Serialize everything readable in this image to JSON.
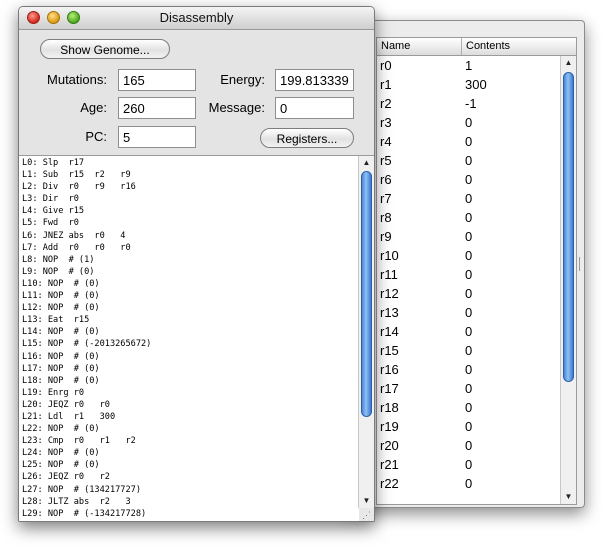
{
  "disassembly_window": {
    "title": "Disassembly",
    "show_genome_label": "Show Genome...",
    "registers_label": "Registers...",
    "fields": {
      "mutations": {
        "label": "Mutations:",
        "value": "165"
      },
      "energy": {
        "label": "Energy:",
        "value": "199.813339"
      },
      "age": {
        "label": "Age:",
        "value": "260"
      },
      "message": {
        "label": "Message:",
        "value": "0"
      },
      "pc": {
        "label": "PC:",
        "value": "5"
      }
    },
    "code": [
      "L0: Slp  r17",
      "L1: Sub  r15  r2   r9",
      "L2: Div  r0   r9   r16",
      "L3: Dir  r0",
      "L4: Give r15",
      "L5: Fwd  r0",
      "L6: JNEZ abs  r0   4",
      "L7: Add  r0   r0   r0",
      "L8: NOP  # (1)",
      "L9: NOP  # (0)",
      "L10: NOP  # (0)",
      "L11: NOP  # (0)",
      "L12: NOP  # (0)",
      "L13: Eat  r15",
      "L14: NOP  # (0)",
      "L15: NOP  # (-2013265672)",
      "L16: NOP  # (0)",
      "L17: NOP  # (0)",
      "L18: NOP  # (0)",
      "L19: Enrg r0",
      "L20: JEQZ r0   r0",
      "L21: Ldl  r1   300",
      "L22: NOP  # (0)",
      "L23: Cmp  r0   r1   r2",
      "L24: NOP  # (0)",
      "L25: NOP  # (0)",
      "L26: JEQZ r0   r2",
      "L27: NOP  # (134217727)",
      "L28: JLTZ abs  r2   3",
      "L29: NOP  # (-134217728)"
    ]
  },
  "registers_window": {
    "columns": {
      "name": "Name",
      "contents": "Contents"
    },
    "rows": [
      {
        "name": "r0",
        "value": "1"
      },
      {
        "name": "r1",
        "value": "300"
      },
      {
        "name": "r2",
        "value": "-1"
      },
      {
        "name": "r3",
        "value": "0"
      },
      {
        "name": "r4",
        "value": "0"
      },
      {
        "name": "r5",
        "value": "0"
      },
      {
        "name": "r6",
        "value": "0"
      },
      {
        "name": "r7",
        "value": "0"
      },
      {
        "name": "r8",
        "value": "0"
      },
      {
        "name": "r9",
        "value": "0"
      },
      {
        "name": "r10",
        "value": "0"
      },
      {
        "name": "r11",
        "value": "0"
      },
      {
        "name": "r12",
        "value": "0"
      },
      {
        "name": "r13",
        "value": "0"
      },
      {
        "name": "r14",
        "value": "0"
      },
      {
        "name": "r15",
        "value": "0"
      },
      {
        "name": "r16",
        "value": "0"
      },
      {
        "name": "r17",
        "value": "0"
      },
      {
        "name": "r18",
        "value": "0"
      },
      {
        "name": "r19",
        "value": "0"
      },
      {
        "name": "r20",
        "value": "0"
      },
      {
        "name": "r21",
        "value": "0"
      },
      {
        "name": "r22",
        "value": "0"
      }
    ]
  },
  "icons": {
    "scroll_up": "scroll-up-arrow-icon",
    "scroll_down": "scroll-down-arrow-icon",
    "resize": "resize-grip-icon"
  },
  "colors": {
    "close": "#d0281a",
    "minimize": "#dc9a10",
    "zoom": "#4ba81c",
    "scroll_thumb": "#4a86d8"
  }
}
